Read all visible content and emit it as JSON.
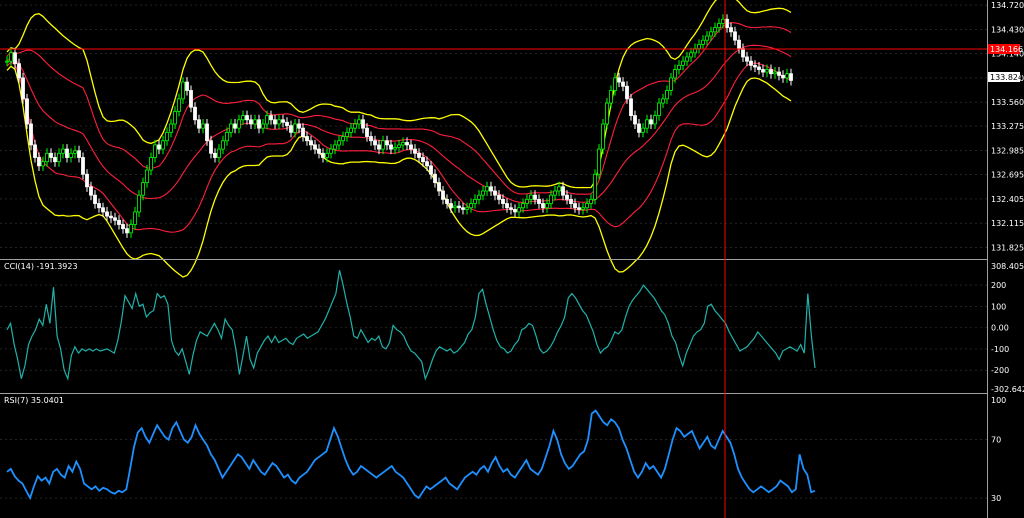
{
  "colors": {
    "background": "#000000",
    "grid": "#3a3a3a",
    "text": "#ffffff",
    "bullish_candle": "#00ff00",
    "bearish_candle": "#ffffff",
    "bollinger_outer": "#ffff00",
    "bollinger_inner": "#ff1f3c",
    "horizontal_line": "#ff0000",
    "crosshair": "#ff0000",
    "cci_line": "#20b2aa",
    "rsi_line": "#1e90ff",
    "price_tag_bg": "#ff0000",
    "current_price_bg": "#ffffff"
  },
  "main_panel": {
    "price_axis_labels": [
      "134.720",
      "134.430",
      "134.140",
      "133.850",
      "133.560",
      "133.275",
      "132.985",
      "132.695",
      "132.405",
      "132.115",
      "131.825"
    ],
    "horizontal_line_tag": "134.166",
    "current_price_tag": "133.824"
  },
  "cci_panel": {
    "title": "CCI(14) -191.3923",
    "axis_labels": [
      "308.4058",
      "200",
      "100",
      "0.00",
      "-100",
      "-200",
      "-302.6421"
    ]
  },
  "rsi_panel": {
    "title": "RSI(7) 35.0401",
    "axis_labels": [
      "100",
      "70",
      "30"
    ]
  },
  "chart_data": [
    {
      "type": "candlestick",
      "title": "",
      "ylim": [
        131.7,
        134.78
      ],
      "x": [
        0,
        4,
        8,
        12,
        16,
        20,
        24,
        28,
        32,
        36,
        40,
        44,
        48,
        52,
        56,
        60,
        64,
        68,
        72,
        76,
        80,
        84,
        88,
        92,
        96,
        100,
        104,
        108,
        112,
        116,
        120,
        124,
        128,
        132,
        136,
        140,
        144,
        148,
        152,
        156,
        160,
        164,
        168,
        172,
        176,
        180,
        184,
        188,
        192,
        196,
        200,
        204,
        208,
        212,
        216,
        220,
        224,
        228,
        232,
        236,
        240,
        244,
        248,
        252,
        256,
        260,
        264,
        268,
        272,
        276,
        280,
        284,
        288,
        292,
        296,
        300,
        304,
        308,
        312,
        316,
        320,
        324,
        328,
        332,
        336,
        340,
        344,
        348,
        352,
        356,
        360,
        364,
        368,
        372,
        376,
        380,
        384,
        388,
        392,
        396,
        400,
        404,
        408,
        412,
        416,
        420,
        424,
        428,
        432,
        436,
        440,
        444,
        448,
        452,
        456,
        460,
        464,
        468,
        472,
        476,
        480,
        484,
        488,
        492,
        496,
        500,
        504,
        508,
        512,
        516,
        520,
        524,
        528,
        532,
        536,
        540,
        544,
        548,
        552,
        556,
        560,
        564,
        568,
        572,
        576,
        580,
        584,
        588,
        592,
        596,
        600,
        604,
        608,
        612,
        616,
        620,
        624,
        628,
        632,
        636,
        640,
        644,
        648,
        652,
        656,
        660,
        664,
        668,
        672,
        676,
        680,
        684,
        688,
        692,
        696,
        700,
        704,
        708,
        712,
        716,
        720,
        724,
        728,
        732,
        736,
        740,
        744,
        748,
        752,
        756,
        760,
        764,
        768,
        772,
        776,
        780,
        784,
        788,
        792,
        796,
        800,
        804,
        808
      ],
      "close": [
        134.05,
        134.15,
        134.02,
        133.85,
        133.6,
        133.3,
        133.05,
        132.9,
        132.8,
        132.85,
        132.95,
        132.9,
        132.85,
        132.95,
        133.0,
        132.9,
        132.95,
        132.98,
        132.9,
        132.7,
        132.55,
        132.45,
        132.35,
        132.3,
        132.25,
        132.2,
        132.18,
        132.15,
        132.1,
        132.05,
        132.0,
        132.1,
        132.25,
        132.45,
        132.6,
        132.75,
        132.9,
        133.05,
        133.0,
        133.1,
        133.2,
        133.3,
        133.45,
        133.6,
        133.8,
        133.7,
        133.5,
        133.35,
        133.25,
        133.3,
        133.1,
        132.95,
        132.9,
        133.0,
        133.1,
        133.2,
        133.3,
        133.25,
        133.35,
        133.4,
        133.35,
        133.3,
        133.35,
        133.25,
        133.3,
        133.4,
        133.35,
        133.3,
        133.35,
        133.32,
        133.28,
        133.2,
        133.3,
        133.25,
        133.15,
        133.1,
        133.05,
        133.0,
        132.95,
        132.9,
        132.95,
        133.0,
        133.05,
        133.1,
        133.15,
        133.2,
        133.25,
        133.3,
        133.35,
        133.25,
        133.15,
        133.1,
        133.05,
        133.0,
        133.1,
        133.05,
        133.0,
        133.02,
        133.05,
        133.08,
        133.05,
        133.0,
        132.95,
        132.9,
        132.85,
        132.8,
        132.7,
        132.6,
        132.5,
        132.4,
        132.35,
        132.3,
        132.32,
        132.3,
        132.28,
        132.3,
        132.35,
        132.4,
        132.45,
        132.5,
        132.55,
        132.5,
        132.45,
        132.4,
        132.35,
        132.3,
        132.28,
        132.25,
        132.3,
        132.35,
        132.4,
        132.45,
        132.4,
        132.35,
        132.3,
        132.35,
        132.45,
        132.5,
        132.55,
        132.45,
        132.4,
        132.35,
        132.3,
        132.28,
        132.3,
        132.35,
        132.4,
        132.7,
        133.0,
        133.3,
        133.55,
        133.7,
        133.85,
        133.8,
        133.75,
        133.6,
        133.4,
        133.3,
        133.2,
        133.25,
        133.35,
        133.3,
        133.4,
        133.55,
        133.6,
        133.7,
        133.85,
        133.95,
        134.0,
        134.05,
        134.1,
        134.15,
        134.2,
        134.25,
        134.3,
        134.35,
        134.4,
        134.45,
        134.5,
        134.55,
        134.45,
        134.4,
        134.3,
        134.2,
        134.1,
        134.05,
        134.0,
        133.98,
        133.95,
        133.92,
        133.95,
        133.9,
        133.92,
        133.88,
        133.85,
        133.9,
        133.82
      ]
    },
    {
      "type": "line",
      "title": "CCI(14) -191.3923",
      "ylim": [
        -302.6421,
        308.4058
      ],
      "series": [
        {
          "name": "CCI(14)",
          "values": [
            -10,
            20,
            -80,
            -150,
            -240,
            -180,
            -80,
            -40,
            -10,
            40,
            10,
            110,
            20,
            190,
            -40,
            -100,
            -200,
            -240,
            -130,
            -90,
            -120,
            -100,
            -110,
            -100,
            -110,
            -100,
            -110,
            -105,
            -100,
            -110,
            -120,
            -60,
            30,
            150,
            120,
            90,
            160,
            100,
            110,
            50,
            70,
            80,
            160,
            140,
            150,
            110,
            -60,
            -110,
            -130,
            -100,
            -160,
            -220,
            -130,
            -60,
            -20,
            -30,
            -40,
            -10,
            20,
            -10,
            -50,
            40,
            10,
            -10,
            -100,
            -220,
            -130,
            -40,
            -150,
            -190,
            -120,
            -90,
            -60,
            -40,
            -70,
            -40,
            -70,
            -60,
            -50,
            -70,
            -80,
            -50,
            -40,
            -30,
            -50,
            -40,
            -30,
            -20,
            10,
            40,
            80,
            120,
            160,
            270,
            200,
            120,
            50,
            -40,
            -50,
            -10,
            -40,
            -70,
            -50,
            -60,
            -40,
            -90,
            -100,
            -70,
            10,
            -10,
            -20,
            -40,
            -80,
            -110,
            -120,
            -140,
            -160,
            -240,
            -200,
            -150,
            -110,
            -90,
            -100,
            -110,
            -100,
            -120,
            -110,
            -90,
            -70,
            -30,
            -10,
            50,
            160,
            180,
            110,
            50,
            -10,
            -60,
            -90,
            -100,
            -120,
            -110,
            -80,
            -60,
            -10,
            0,
            20,
            10,
            -40,
            -100,
            -120,
            -110,
            -90,
            -60,
            -20,
            10,
            50,
            140,
            160,
            140,
            110,
            80,
            60,
            20,
            -20,
            -80,
            -120,
            -100,
            -90,
            -60,
            -20,
            -30,
            -10,
            50,
            100,
            130,
            150,
            170,
            200,
            180,
            160,
            140,
            110,
            80,
            60,
            20,
            -40,
            -70,
            -130,
            -180,
            -120,
            -80,
            -40,
            -20,
            -10,
            20,
            100,
            110,
            80,
            60,
            40,
            20,
            -20,
            -50,
            -80,
            -110,
            -100,
            -90,
            -70,
            -50,
            -20,
            -40,
            -60,
            -80,
            -100,
            -120,
            -150,
            -110,
            -100,
            -90,
            -100,
            -110,
            -80,
            -120,
            160,
            -40,
            -190
          ]
        }
      ]
    },
    {
      "type": "line",
      "title": "RSI(7) 35.0401",
      "ylim": [
        17,
        100
      ],
      "series": [
        {
          "name": "RSI(7)",
          "values": [
            48,
            50,
            45,
            42,
            40,
            35,
            30,
            38,
            45,
            42,
            44,
            40,
            48,
            50,
            46,
            44,
            52,
            48,
            55,
            50,
            40,
            38,
            36,
            38,
            35,
            37,
            36,
            34,
            33,
            35,
            34,
            36,
            50,
            65,
            75,
            78,
            72,
            68,
            74,
            80,
            76,
            72,
            70,
            78,
            82,
            76,
            70,
            68,
            72,
            80,
            74,
            70,
            66,
            60,
            56,
            50,
            44,
            48,
            52,
            56,
            60,
            58,
            54,
            50,
            56,
            52,
            48,
            46,
            50,
            54,
            52,
            48,
            44,
            46,
            42,
            40,
            44,
            46,
            48,
            52,
            56,
            58,
            60,
            62,
            70,
            78,
            72,
            64,
            56,
            50,
            46,
            48,
            52,
            50,
            48,
            46,
            44,
            46,
            48,
            50,
            52,
            48,
            46,
            44,
            40,
            36,
            32,
            30,
            34,
            38,
            36,
            38,
            40,
            42,
            44,
            40,
            38,
            36,
            40,
            44,
            46,
            48,
            46,
            50,
            52,
            48,
            54,
            58,
            52,
            48,
            50,
            46,
            44,
            48,
            52,
            56,
            50,
            48,
            46,
            50,
            58,
            66,
            76,
            70,
            60,
            54,
            50,
            52,
            56,
            60,
            62,
            70,
            88,
            90,
            86,
            82,
            80,
            84,
            82,
            78,
            70,
            64,
            56,
            48,
            44,
            48,
            54,
            50,
            52,
            48,
            44,
            50,
            60,
            70,
            78,
            76,
            72,
            74,
            76,
            70,
            64,
            68,
            72,
            66,
            64,
            70,
            76,
            72,
            68,
            60,
            50,
            44,
            40,
            36,
            34,
            36,
            38,
            36,
            34,
            36,
            38,
            42,
            40,
            38,
            34,
            36,
            60,
            50,
            46,
            34,
            35
          ]
        }
      ]
    }
  ]
}
